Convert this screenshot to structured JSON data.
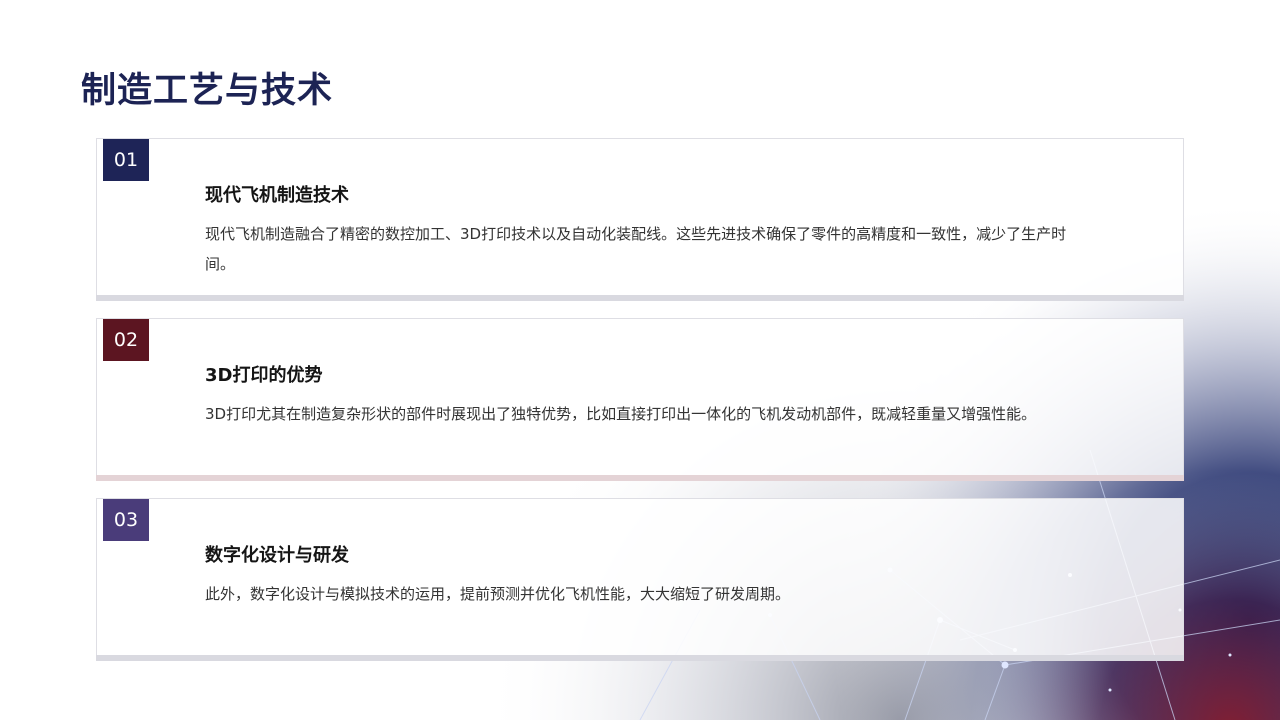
{
  "page": {
    "title": "制造工艺与技术"
  },
  "cards": [
    {
      "number": "01",
      "title": "现代飞机制造技术",
      "body": "现代飞机制造融合了精密的数控加工、3D打印技术以及自动化装配线。这些先进技术确保了零件的高精度和一致性，减少了生产时间。",
      "badge_color": "#1e2457"
    },
    {
      "number": "02",
      "title": "3D打印的优势",
      "body": "3D打印尤其在制造复杂形状的部件时展现出了独特优势，比如直接打印出一体化的飞机发动机部件，既减轻重量又增强性能。",
      "badge_color": "#5c1521"
    },
    {
      "number": "03",
      "title": "数字化设计与研发",
      "body": "此外，数字化设计与模拟技术的运用，提前预测并优化飞机性能，大大缩短了研发周期。",
      "badge_color": "#4a3c7a"
    }
  ],
  "colors": {
    "title": "#1c2354",
    "navy": "#1e2457",
    "crimson": "#5c1521",
    "purple": "#4a3c7a"
  }
}
